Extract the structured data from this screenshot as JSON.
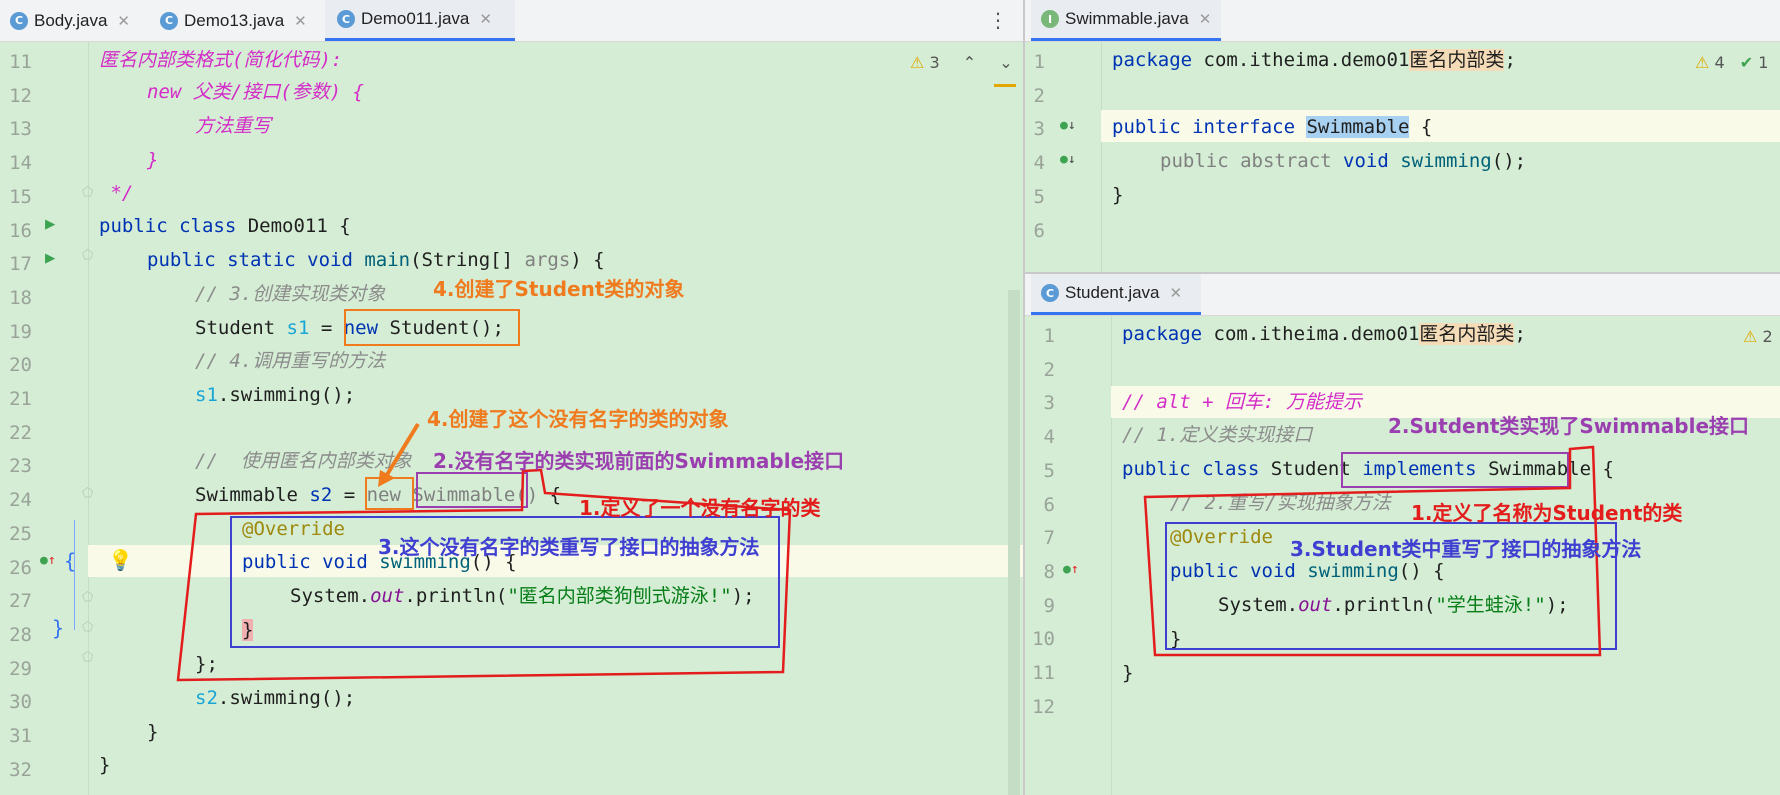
{
  "left_tabs": [
    {
      "label": "Body.java",
      "icon": "class-icon"
    },
    {
      "label": "Demo13.java",
      "icon": "class-icon"
    },
    {
      "label": "Demo011.java",
      "icon": "class-icon",
      "active": true
    }
  ],
  "left_warnings": "3",
  "left_lines": [
    "11",
    "12",
    "13",
    "14",
    "15",
    "16",
    "17",
    "18",
    "19",
    "20",
    "21",
    "22",
    "23",
    "24",
    "25",
    "26",
    "27",
    "28",
    "29",
    "30",
    "31",
    "32"
  ],
  "left_code": {
    "l11": "匿名内部类格式(简化代码):",
    "l12_kw": "new ",
    "l12_rest": "父类/接口(参数) {",
    "l13": "方法重写",
    "l14": "}",
    "l15": " */",
    "l16_kw": "public class ",
    "l16_rest": "Demo011 {",
    "l17_kw": "public static void ",
    "l17_m": "main",
    "l17_a": "(String[] ",
    "l17_args": "args",
    "l17_b": ") {",
    "l18": "// 3.创建实现类对象",
    "l19_a": "Student ",
    "l19_v": "s1",
    "l19_b": " = ",
    "l19_kw": "new ",
    "l19_c": "Student();",
    "l20": "// 4.调用重写的方法",
    "l21_v": "s1",
    "l21_b": ".swimming();",
    "l23": "//  使用匿名内部类对象",
    "l24_a": "Swimmable ",
    "l24_v": "s2",
    "l24_b": " = ",
    "l24_kw": "new ",
    "l24_c": "Swimmable",
    "l24_d": "()",
    " l24_e": " {",
    "l25": "@Override",
    "l26_kw": "public void ",
    "l26_m": "swimming",
    "l26_b": "() {",
    "l27_a": "System.",
    "l27_out": "out",
    "l27_b": ".println(",
    "l27_s": "\"匿名内部类狗刨式游泳!\"",
    "l27_c": ");",
    "l28": "}",
    "l29": "};",
    "l30_v": "s2",
    "l30_b": ".swimming();",
    "l31": "}",
    "l32": "}"
  },
  "left_ann": {
    "a1": "4.创建了Student类的对象",
    "a2": "4.创建了这个没有名字的类的对象",
    "a3": "2.没有名字的类实现前面的Swimmable接口",
    "a4": "1.定义了一个没有名字的类",
    "a5": "3.这个没有名字的类重写了接口的抽象方法"
  },
  "top_right_tab": {
    "label": "Swimmable.java",
    "icon": "interface-icon"
  },
  "tr_warnings": "4",
  "tr_checks": "1",
  "tr_lines": [
    "1",
    "2",
    "3",
    "4",
    "5",
    "6"
  ],
  "tr_code": {
    "l1_kw": "package ",
    "l1_a": "com.itheima.demo01",
    "l1_hl": "匿名内部类",
    ";": ";",
    "l3_kw": "public interface ",
    "l3_hl": "Swimmable",
    "l3_b": " {",
    "l4_a": "public abstract ",
    "l4_kw": "void ",
    "l4_m": "swimming",
    "l4_b": "();",
    "l5": "}"
  },
  "bottom_right_tab": {
    "label": "Student.java",
    "icon": "class-icon"
  },
  "br_warnings": "2",
  "br_lines": [
    "1",
    "2",
    "3",
    "4",
    "5",
    "6",
    "7",
    "8",
    "9",
    "10",
    "11",
    "12"
  ],
  "br_code": {
    "l1_kw": "package ",
    "l1_a": "com.itheima.demo01",
    "l1_hl": "匿名内部类",
    "l1_b": ";",
    "l3": "// alt + 回车: 万能提示",
    "l4": "// 1.定义类实现接口",
    "l5_kw": "public class ",
    "l5_a": "Student ",
    "l5_kw2": "implements ",
    "l5_b": "Swimmable",
    " l5_c": " {",
    "l6": "// 2.重写/实现抽象方法",
    "l7": "@Override",
    "l8_kw": "public void ",
    "l8_m": "swimming",
    "l8_b": "() {",
    "l9_a": "System.",
    "l9_out": "out",
    "l9_b": ".println(",
    "l9_s": "\"学生蛙泳!\"",
    "l9_c": ");",
    "l10": "}",
    "l11": "}"
  },
  "br_ann": {
    "a1": "2.Sutdent类实现了Swimmable接口",
    "a2": "1.定义了名称为Student的类",
    "a3": "3.Student类中重写了接口的抽象方法"
  },
  "colors": {
    "orange": "#f07a1e",
    "purple": "#9b3fb0",
    "red": "#e41c1c",
    "blue": "#3f3fd1",
    "keyword": "#0033b3"
  }
}
